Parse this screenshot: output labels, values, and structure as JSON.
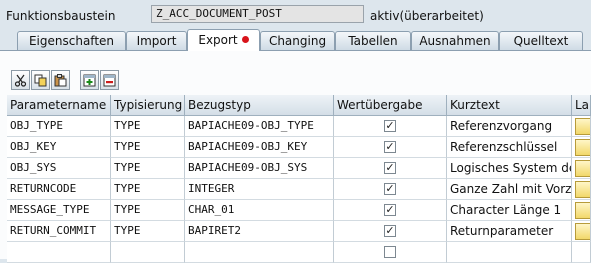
{
  "header": {
    "label": "Funktionsbaustein",
    "value": "Z_ACC_DOCUMENT_POST",
    "status": "aktiv(überarbeitet)"
  },
  "tabs": [
    {
      "label": "Eigenschaften",
      "active": false
    },
    {
      "label": "Import",
      "active": false
    },
    {
      "label": "Export",
      "active": true,
      "modified": true
    },
    {
      "label": "Changing",
      "active": false
    },
    {
      "label": "Tabellen",
      "active": false
    },
    {
      "label": "Ausnahmen",
      "active": false
    },
    {
      "label": "Quelltext",
      "active": false
    }
  ],
  "toolbar": {
    "buttons": [
      "cut-icon",
      "copy-icon",
      "paste-icon",
      "insert-row-icon",
      "delete-row-icon"
    ]
  },
  "table": {
    "columns": [
      "Parametername",
      "Typisierung",
      "Bezugstyp",
      "Wertübergabe",
      "Kurztext",
      "La"
    ],
    "rows": [
      {
        "name": "OBJ_TYPE",
        "typing": "TYPE",
        "ref": "BAPIACHE09-OBJ_TYPE",
        "pass_value": true,
        "text": "Referenzvorgang"
      },
      {
        "name": "OBJ_KEY",
        "typing": "TYPE",
        "ref": "BAPIACHE09-OBJ_KEY",
        "pass_value": true,
        "text": "Referenzschlüssel"
      },
      {
        "name": "OBJ_SYS",
        "typing": "TYPE",
        "ref": "BAPIACHE09-OBJ_SYS",
        "pass_value": true,
        "text": "Logisches System de..."
      },
      {
        "name": "RETURNCODE",
        "typing": "TYPE",
        "ref": "INTEGER",
        "pass_value": true,
        "text": "Ganze Zahl mit Vorzei..."
      },
      {
        "name": "MESSAGE_TYPE",
        "typing": "TYPE",
        "ref": "CHAR_01",
        "pass_value": true,
        "text": "Character Länge 1"
      },
      {
        "name": "RETURN_COMMIT",
        "typing": "TYPE",
        "ref": "BAPIRET2",
        "pass_value": true,
        "text": "Returnparameter"
      },
      {
        "name": "",
        "typing": "",
        "ref": "",
        "pass_value": false,
        "text": ""
      }
    ]
  },
  "colors": {
    "background": "#dde6ed",
    "modified_dot": "#d8141b",
    "long_text_button": "#f2d86a"
  }
}
